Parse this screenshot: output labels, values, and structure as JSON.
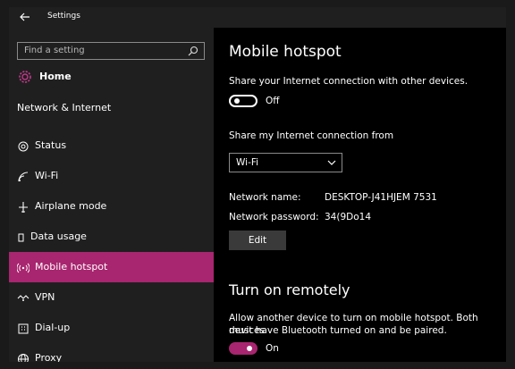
{
  "window": {
    "title": "Settings"
  },
  "sidebar": {
    "search_placeholder": "Find a setting",
    "home_label": "Home",
    "section_label": "Network & Internet",
    "items": [
      {
        "label": "Status",
        "icon": "globe-icon"
      },
      {
        "label": "Wi-Fi",
        "icon": "wifi-icon"
      },
      {
        "label": "Airplane mode",
        "icon": "airplane-icon"
      },
      {
        "label": "Data usage",
        "icon": "data-usage-icon"
      },
      {
        "label": "Mobile hotspot",
        "icon": "hotspot-icon",
        "active": true
      },
      {
        "label": "VPN",
        "icon": "vpn-icon"
      },
      {
        "label": "Dial-up",
        "icon": "dialup-icon"
      },
      {
        "label": "Proxy",
        "icon": "proxy-icon"
      }
    ]
  },
  "main": {
    "title": "Mobile hotspot",
    "share_description": "Share your Internet connection with other devices.",
    "share_toggle": {
      "state": "Off",
      "on": false
    },
    "share_from_label": "Share my Internet connection from",
    "share_from_value": "Wi-Fi",
    "network_name_label": "Network name:",
    "network_name_value": "DESKTOP-J41HJEM 7531",
    "network_password_label": "Network password:",
    "network_password_value": "34(9Do14",
    "edit_label": "Edit",
    "remote_title": "Turn on remotely",
    "remote_description_line1": "Allow another device to turn on mobile hotspot. Both devices",
    "remote_description_line2": "must have Bluetooth turned on and be paired.",
    "remote_toggle": {
      "state": "On",
      "on": true
    }
  },
  "colors": {
    "accent": "#a8256f",
    "sidebar_bg": "#1f1f1f",
    "content_bg": "#000000"
  }
}
